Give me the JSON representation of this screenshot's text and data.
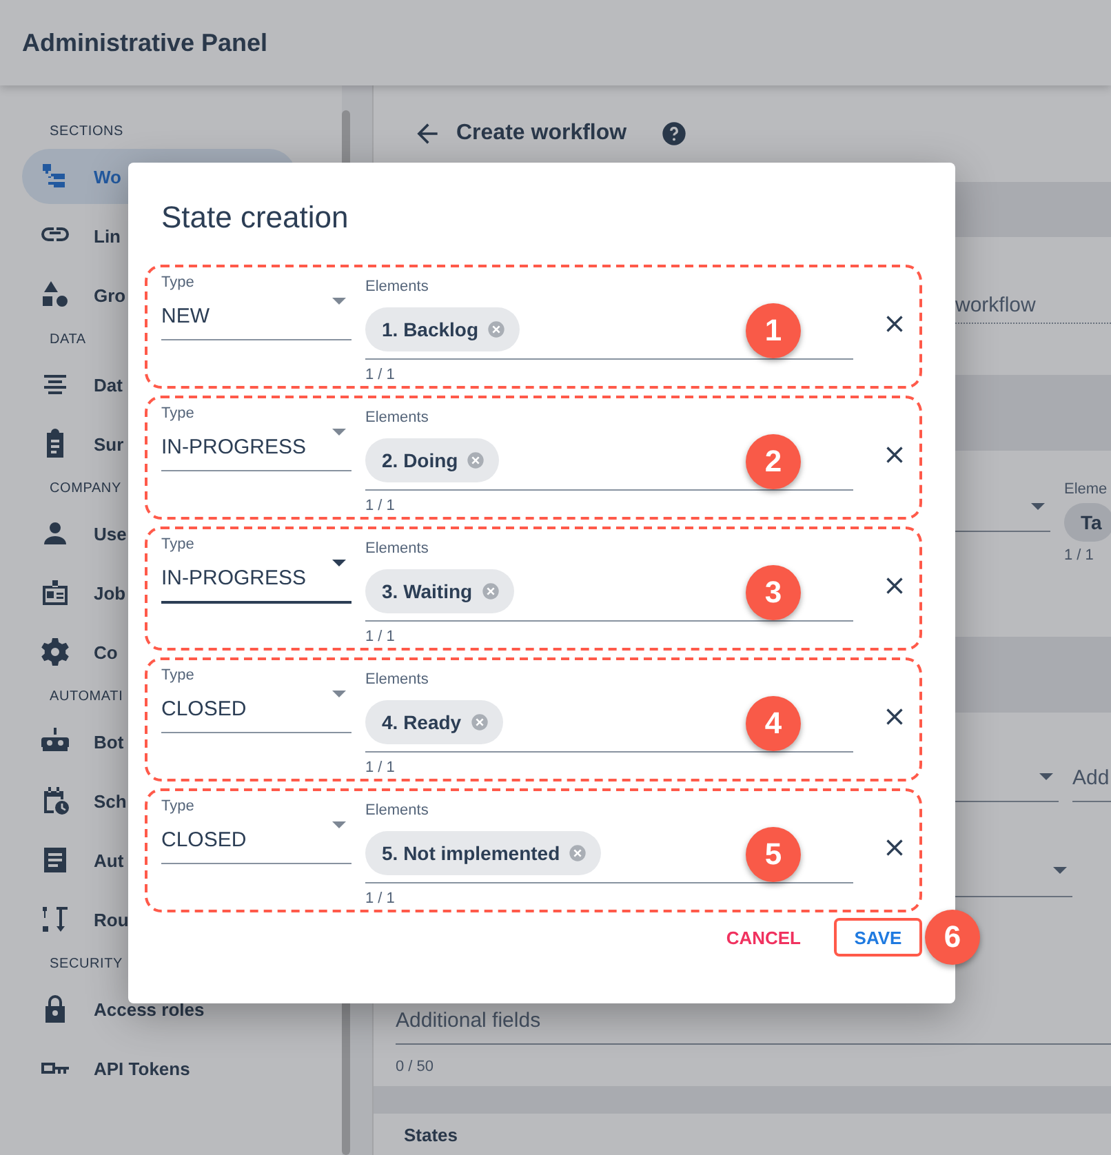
{
  "app": {
    "title": "Administrative Panel"
  },
  "sidebar": {
    "sections": [
      {
        "heading": "SECTIONS",
        "items": [
          {
            "label": "Wo",
            "selected": true
          },
          {
            "label": "Lin",
            "selected": false
          },
          {
            "label": "Gro",
            "selected": false
          }
        ]
      },
      {
        "heading": "DATA",
        "items": [
          {
            "label": "Dat",
            "selected": false
          },
          {
            "label": "Sur",
            "selected": false
          }
        ]
      },
      {
        "heading": "COMPANY",
        "items": [
          {
            "label": "Use",
            "selected": false
          },
          {
            "label": "Job",
            "selected": false
          },
          {
            "label": "Co",
            "selected": false
          }
        ]
      },
      {
        "heading": "AUTOMATI",
        "items": [
          {
            "label": "Bot",
            "selected": false
          },
          {
            "label": "Sch",
            "selected": false
          },
          {
            "label": "Aut",
            "selected": false
          },
          {
            "label": "Rou",
            "selected": false
          }
        ]
      },
      {
        "heading": "SECURITY",
        "items": [
          {
            "label": "Access roles",
            "selected": false
          },
          {
            "label": "API Tokens",
            "selected": false
          }
        ]
      }
    ]
  },
  "main": {
    "title": "Create workflow",
    "field_1_text": "workflow",
    "field_2_label": "Eleme",
    "field_2_chip": "Ta",
    "field_2_counter": "1 / 1",
    "field_3_text": "Add",
    "additional_fields": {
      "placeholder": "Additional fields",
      "counter": "0 / 50"
    },
    "states_heading": "States"
  },
  "dialog": {
    "title": "State creation",
    "states": [
      {
        "type_label": "Type",
        "type": "NEW",
        "focused": false,
        "elements_label": "Elements",
        "elements": [
          "1. Backlog"
        ],
        "counter": "1 / 1",
        "marker": "1"
      },
      {
        "type_label": "Type",
        "type": "IN-PROGRESS",
        "focused": false,
        "elements_label": "Elements",
        "elements": [
          "2. Doing"
        ],
        "counter": "1 / 1",
        "marker": "2"
      },
      {
        "type_label": "Type",
        "type": "IN-PROGRESS",
        "focused": true,
        "elements_label": "Elements",
        "elements": [
          "3. Waiting"
        ],
        "counter": "1 / 1",
        "marker": "3"
      },
      {
        "type_label": "Type",
        "type": "CLOSED",
        "focused": false,
        "elements_label": "Elements",
        "elements": [
          "4. Ready"
        ],
        "counter": "1 / 1",
        "marker": "4"
      },
      {
        "type_label": "Type",
        "type": "CLOSED",
        "focused": false,
        "elements_label": "Elements",
        "elements": [
          "5. Not implemented"
        ],
        "counter": "1 / 1",
        "marker": "5"
      }
    ],
    "cancel": "CANCEL",
    "save": "SAVE",
    "save_marker": "6"
  }
}
